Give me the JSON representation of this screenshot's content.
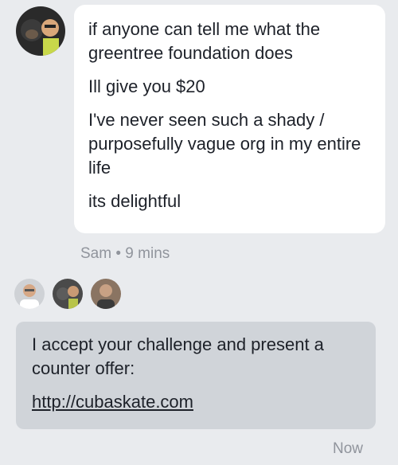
{
  "incoming": {
    "messages": [
      "if anyone can tell me what the greentree foundation does",
      "Ill give you $20",
      "I've never seen such a shady / purposefully vague org in my entire life",
      "its delightful"
    ],
    "sender": "Sam",
    "separator": "•",
    "time": "9 mins"
  },
  "outgoing": {
    "message": "I accept your challenge and present a counter offer:",
    "link": "http://cubaskate.com",
    "time": "Now"
  },
  "colors": {
    "background": "#e9ebee",
    "incoming_bubble": "#ffffff",
    "outgoing_bubble": "#d0d4d9",
    "meta_text": "#90949c"
  },
  "icons": {
    "sender_avatar": "user-avatar-icon",
    "read_receipts": [
      "user-avatar-icon",
      "user-avatar-icon",
      "user-avatar-icon"
    ]
  }
}
